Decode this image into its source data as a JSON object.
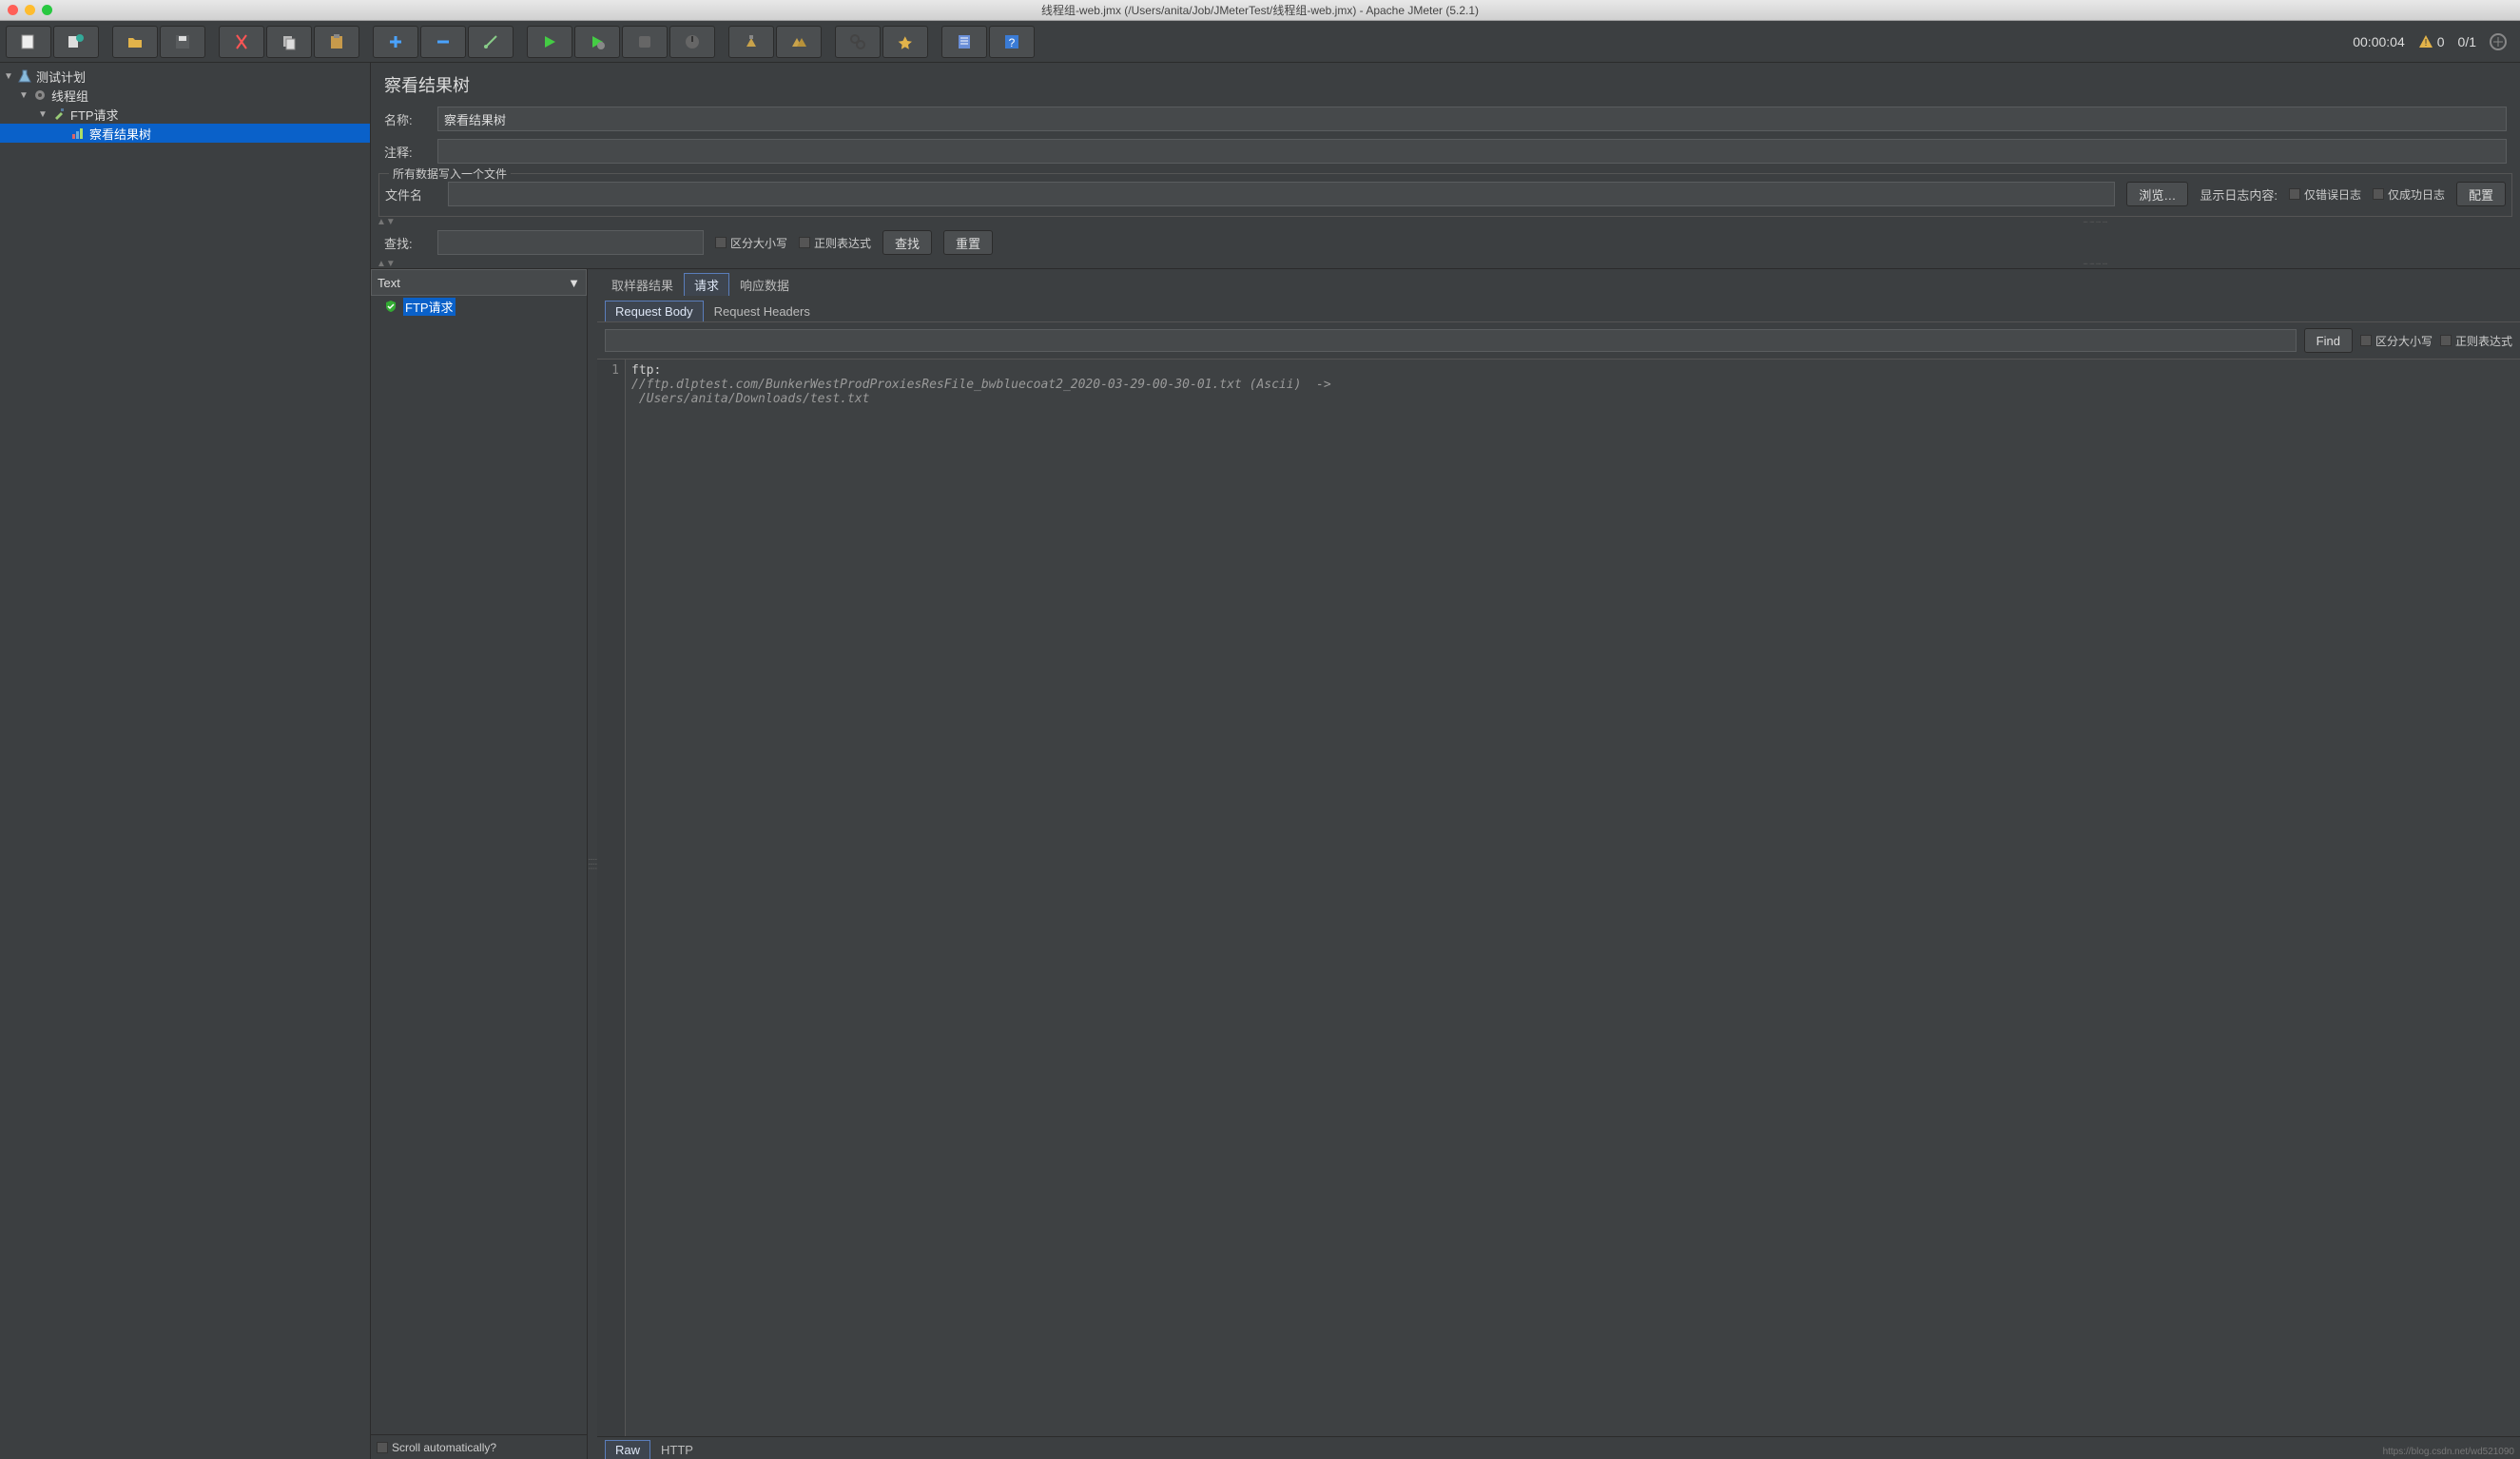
{
  "window": {
    "title": "线程组-web.jmx (/Users/anita/Job/JMeterTest/线程组-web.jmx) - Apache JMeter (5.2.1)"
  },
  "toolbar": {
    "timer": "00:00:04",
    "warn_count": "0",
    "thread_count": "0/1"
  },
  "tree": {
    "plan": "测试计划",
    "thread_group": "线程组",
    "ftp_request": "FTP请求",
    "view_results": "察看结果树"
  },
  "panel": {
    "title": "察看结果树",
    "name_label": "名称:",
    "name_value": "察看结果树",
    "comment_label": "注释:",
    "comment_value": "",
    "file_legend": "所有数据写入一个文件",
    "filename_label": "文件名",
    "filename_value": "",
    "browse": "浏览…",
    "show_log": "显示日志内容:",
    "only_err": "仅错误日志",
    "only_ok": "仅成功日志",
    "configure": "配置",
    "search_label": "查找:",
    "search_value": "",
    "case_sensitive": "区分大小写",
    "regex": "正则表达式",
    "search_btn": "查找",
    "reset_btn": "重置"
  },
  "samples": {
    "renderer": "Text",
    "item0": "FTP请求",
    "scroll_label": "Scroll automatically?"
  },
  "detail": {
    "tabs": {
      "sampler": "取样器结果",
      "request": "请求",
      "response": "响应数据"
    },
    "subtabs": {
      "body": "Request Body",
      "headers": "Request Headers"
    },
    "find": {
      "btn": "Find",
      "case": "区分大小写",
      "regex": "正则表达式",
      "value": ""
    },
    "code_line": "1",
    "code_l1": "ftp:",
    "code_l2": "//ftp.dlptest.com/BunkerWestProdProxiesResFile_bwbluecoat2_2020-03-29-00-30-01.txt (Ascii)  ->",
    "code_l3": " /Users/anita/Downloads/test.txt",
    "bottom": {
      "raw": "Raw",
      "http": "HTTP"
    }
  },
  "watermark": "https://blog.csdn.net/wd521090"
}
